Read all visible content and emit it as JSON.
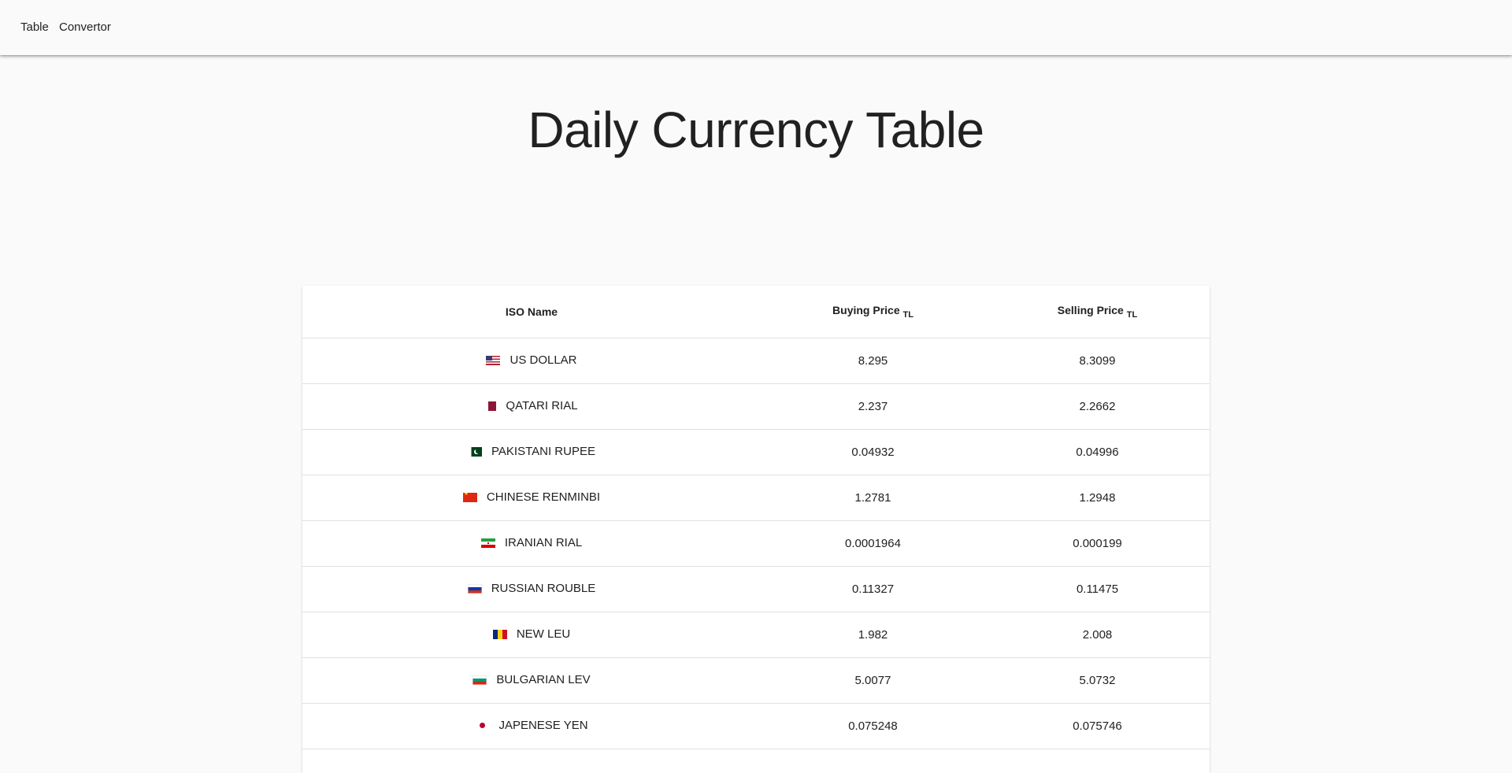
{
  "nav": {
    "items": [
      {
        "label": "Table"
      },
      {
        "label": "Convertor"
      }
    ]
  },
  "page": {
    "title": "Daily Currency Table"
  },
  "table": {
    "headers": {
      "iso_name": "ISO Name",
      "buying": "Buying Price",
      "buying_unit": "TL",
      "selling": "Selling Price",
      "selling_unit": "TL"
    },
    "rows": [
      {
        "flag": "us-flag-icon",
        "name": "US DOLLAR",
        "buy": "8.295",
        "sell": "8.3099"
      },
      {
        "flag": "qatar-flag-icon",
        "name": "QATARI RIAL",
        "buy": "2.237",
        "sell": "2.2662"
      },
      {
        "flag": "pakistan-flag-icon",
        "name": "PAKISTANI RUPEE",
        "buy": "0.04932",
        "sell": "0.04996"
      },
      {
        "flag": "china-flag-icon",
        "name": "CHINESE RENMINBI",
        "buy": "1.2781",
        "sell": "1.2948"
      },
      {
        "flag": "iran-flag-icon",
        "name": "IRANIAN RIAL",
        "buy": "0.0001964",
        "sell": "0.000199"
      },
      {
        "flag": "russia-flag-icon",
        "name": "RUSSIAN ROUBLE",
        "buy": "0.11327",
        "sell": "0.11475"
      },
      {
        "flag": "romania-flag-icon",
        "name": "NEW LEU",
        "buy": "1.982",
        "sell": "2.008"
      },
      {
        "flag": "bulgaria-flag-icon",
        "name": "BULGARIAN LEV",
        "buy": "5.0077",
        "sell": "5.0732"
      },
      {
        "flag": "japan-flag-icon",
        "name": "JAPENESE YEN",
        "buy": "0.075248",
        "sell": "0.075746"
      }
    ]
  }
}
